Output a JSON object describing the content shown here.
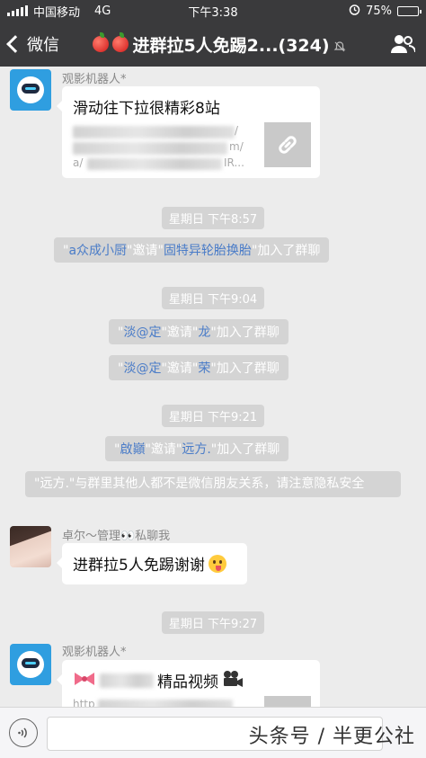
{
  "status_bar": {
    "carrier": "中国移动",
    "network": "4G",
    "time": "下午3:38",
    "battery_percent": "75%",
    "battery_level": 0.75
  },
  "nav": {
    "back_label": "微信",
    "title": "进群拉5人免踢2...(324)",
    "icons": [
      "chevron-left-icon",
      "apple-emoji-icon",
      "mute-icon",
      "group-members-icon"
    ]
  },
  "messages": {
    "bot_name": "观影机器人*",
    "card1": {
      "title": "滑动往下拉很精彩8站",
      "url_line1_tail": "/",
      "url_line2_tail": "m/",
      "url_line3_head": "a/",
      "url_line3_tail": "IR..."
    },
    "time1": "星期日 下午8:57",
    "sys1": {
      "q1": "\"",
      "inviter": "a众成小厨",
      "mid": "\"邀请\"",
      "invitee": "固特异轮胎换胎",
      "tail": "\"加入了群聊"
    },
    "time2": "星期日 下午9:04",
    "sys2": {
      "q1": "\"",
      "inviter": "淡@定",
      "mid": "\"邀请\"",
      "invitee": "龙",
      "tail": "\"加入了群聊"
    },
    "sys3": {
      "q1": "\"",
      "inviter": "淡@定",
      "mid": "\"邀请\"",
      "invitee": "荣",
      "tail": "\"加入了群聊"
    },
    "time3": "星期日 下午9:21",
    "sys4": {
      "q1": "\"",
      "inviter": "啟巓",
      "mid": "\"邀请\"",
      "invitee": "远方.",
      "tail": "\"加入了群聊"
    },
    "sys5": "\"远方.\"与群里其他人都不是微信朋友关系，请注意隐私安全",
    "user_name": "卓尔～管理👀私聊我",
    "user_message": "进群拉5人免踢谢谢",
    "time4": "星期日 下午9:27",
    "card2": {
      "title": "精品视频",
      "url_head": "http"
    }
  },
  "bottom": {
    "watermark": "头条号 / 半更公社"
  },
  "colors": {
    "bar": "#3a3a3c",
    "chat_bg": "#ececec",
    "name_link": "#4a7cc8",
    "system_bubble": "#d4d4d4"
  }
}
